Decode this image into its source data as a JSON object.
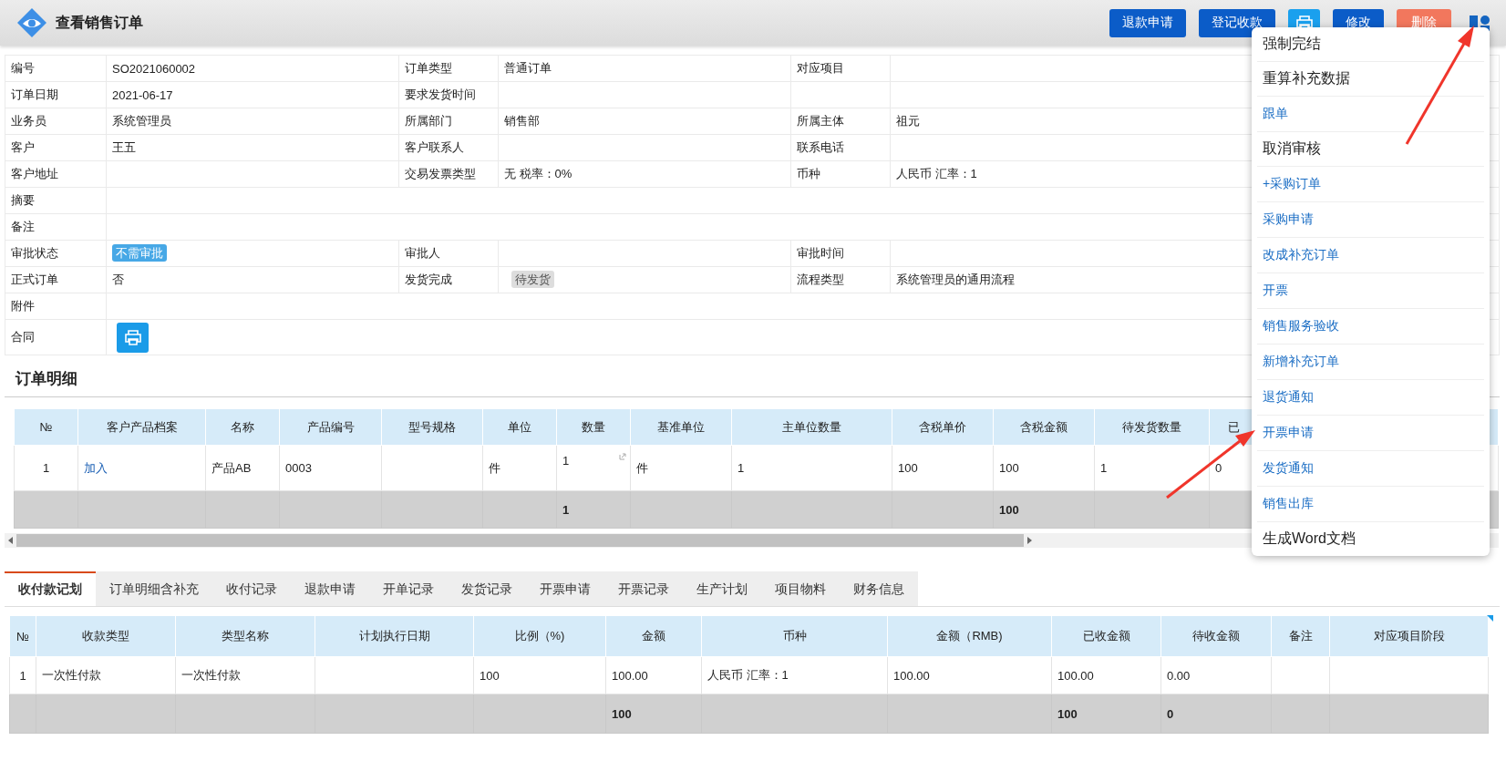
{
  "header": {
    "title": "查看销售订单",
    "buttons": [
      {
        "label": "退款申请",
        "kind": "primary"
      },
      {
        "label": "登记收款",
        "kind": "primary"
      },
      {
        "kind": "print"
      },
      {
        "label": "修改",
        "kind": "primary"
      },
      {
        "label": "删除",
        "kind": "danger"
      }
    ]
  },
  "form": [
    [
      {
        "label": "编号",
        "value": "SO2021060002",
        "kind": "text"
      },
      {
        "label": "订单类型",
        "value": "普通订单",
        "kind": "text"
      },
      {
        "label": "对应项目",
        "kind": "text"
      }
    ],
    [
      {
        "label": "订单日期",
        "value": "2021-06-17",
        "kind": "text"
      },
      {
        "label": "要求发货时间",
        "kind": "text"
      },
      {
        "kind": "text"
      }
    ],
    [
      {
        "label": "业务员",
        "value": "系统管理员",
        "kind": "text"
      },
      {
        "label": "所属部门",
        "value": "销售部",
        "kind": "text"
      },
      {
        "label": "所属主体",
        "value": "祖元",
        "kind": "text"
      }
    ],
    [
      {
        "label": "客户",
        "value": "王五",
        "kind": "text"
      },
      {
        "label": "客户联系人",
        "kind": "text"
      },
      {
        "label": "联系电话",
        "kind": "text"
      }
    ],
    [
      {
        "label": "客户地址",
        "kind": "text"
      },
      {
        "label": "交易发票类型",
        "value": "无 税率：0%",
        "kind": "text"
      },
      {
        "label": "币种",
        "value": "人民币 汇率：1",
        "kind": "text"
      }
    ],
    [
      {
        "label": "摘要",
        "kind": "text"
      }
    ],
    [
      {
        "label": "备注",
        "kind": "text"
      }
    ],
    [
      {
        "label": "审批状态",
        "value": "不需审批",
        "kind": "badge"
      },
      {
        "label": "审批人",
        "kind": "text"
      },
      {
        "label": "审批时间",
        "kind": "text"
      }
    ],
    [
      {
        "label": "正式订单",
        "value": "否",
        "kind": "text"
      },
      {
        "label": "发货完成",
        "value": "待发货",
        "kind": "tag"
      },
      {
        "label": "流程类型",
        "value": "系统管理员的通用流程",
        "kind": "text"
      }
    ],
    [
      {
        "label": "附件",
        "kind": "text"
      }
    ],
    [
      {
        "label": "合同",
        "kind": "print"
      }
    ]
  ],
  "details": {
    "title": "订单明细",
    "columns": [
      {
        "label": "№",
        "kind": "index"
      },
      {
        "label": "客户产品档案",
        "kind": "link"
      },
      {
        "label": "名称",
        "kind": "text"
      },
      {
        "label": "产品编号",
        "kind": "text"
      },
      {
        "label": "型号规格",
        "kind": "text"
      },
      {
        "label": "单位",
        "kind": "text"
      },
      {
        "label": "数量",
        "kind": "input"
      },
      {
        "label": "基准单位",
        "kind": "text"
      },
      {
        "label": "主单位数量",
        "kind": "text"
      },
      {
        "label": "含税单价",
        "kind": "text"
      },
      {
        "label": "含税金额",
        "kind": "text"
      },
      {
        "label": "待发货数量",
        "kind": "text"
      },
      {
        "label": "已",
        "kind": "text"
      }
    ],
    "rows": [
      {
        "col_1": "1",
        "col_2": "加入",
        "col_3": "产品AB",
        "col_4": "0003",
        "col_6": "件",
        "col_7": "1",
        "col_8": "件",
        "col_9": "1",
        "col_10": "100",
        "col_11": "100",
        "col_12": "1",
        "col_13": "0"
      }
    ],
    "total": {
      "col_7": "1",
      "col_11": "100"
    }
  },
  "tabs": [
    {
      "label": "收付款记划",
      "selected": true
    },
    {
      "label": "订单明细含补充",
      "selected": false
    },
    {
      "label": "收付记录",
      "selected": false
    },
    {
      "label": "退款申请",
      "selected": false
    },
    {
      "label": "开单记录",
      "selected": false
    },
    {
      "label": "发货记录",
      "selected": false
    },
    {
      "label": "开票申请",
      "selected": false
    },
    {
      "label": "开票记录",
      "selected": false
    },
    {
      "label": "生产计划",
      "selected": false
    },
    {
      "label": "项目物料",
      "selected": false
    },
    {
      "label": "财务信息",
      "selected": false
    }
  ],
  "payments": {
    "columns": [
      "№",
      "收款类型",
      "类型名称",
      "计划执行日期",
      "比例（%)",
      "金额",
      "币种",
      "金额（RMB)",
      "已收金额",
      "待收金额",
      "备注",
      "对应项目阶段"
    ],
    "rows": [
      {
        "col_1": "1",
        "col_2": "一次性付款",
        "col_3": "一次性付款",
        "col_5": "100",
        "col_6": "100.00",
        "col_7": "人民币 汇率：1",
        "col_8": "100.00",
        "col_9": "100.00",
        "col_10": "0.00"
      }
    ],
    "total": {
      "col_6": "100",
      "col_9": "100",
      "col_10": "0"
    }
  },
  "menu": [
    {
      "label": "强制完结",
      "kind": "action"
    },
    {
      "label": "重算补充数据",
      "kind": "action"
    },
    {
      "label": "跟单",
      "kind": "link"
    },
    {
      "label": "取消审核",
      "kind": "action"
    },
    {
      "label": "+采购订单",
      "kind": "link"
    },
    {
      "label": "采购申请",
      "kind": "link"
    },
    {
      "label": "改成补充订单",
      "kind": "link"
    },
    {
      "label": "开票",
      "kind": "link"
    },
    {
      "label": "销售服务验收",
      "kind": "link"
    },
    {
      "label": "新增补充订单",
      "kind": "link"
    },
    {
      "label": "退货通知",
      "kind": "link"
    },
    {
      "label": "开票申请",
      "kind": "link"
    },
    {
      "label": "发货通知",
      "kind": "link"
    },
    {
      "label": "销售出库",
      "kind": "link"
    },
    {
      "label": "生成Word文档",
      "kind": "action"
    }
  ]
}
